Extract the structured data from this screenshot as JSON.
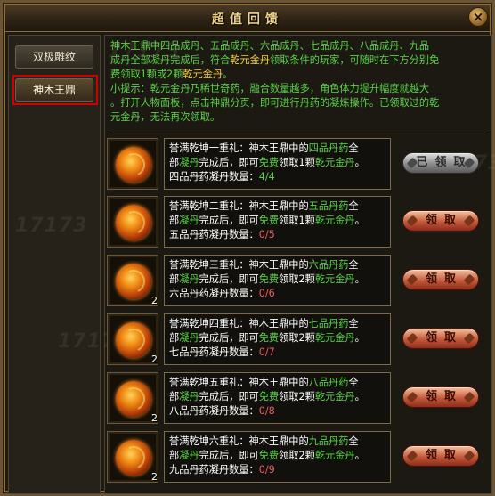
{
  "window": {
    "title": "超值回馈",
    "close_label": "×"
  },
  "sidebar": {
    "items": [
      {
        "label": "双极雕纹"
      },
      {
        "label": "神木王鼎"
      }
    ]
  },
  "description": {
    "line1": "神木王鼎中四品成丹、五品成丹、六品成丹、七品成丹、八品成丹、九品",
    "line2a": "成丹全部凝丹完成后，符合",
    "line2b": "乾元金丹",
    "line2c": "领取条件的玩家，可随时在下方分别免",
    "line3a": "费领取1颗或2颗",
    "line3b": "乾元金丹",
    "line3c": "。",
    "line4": "    小提示：乾元金丹乃稀世奇药，融合数量越多，角色体力提升幅度就越大",
    "line5": "。打开人物面板，点击神鼎分页，即可进行丹药的凝炼操作。已领取过的乾",
    "line6": "元金丹，无法再次领取。"
  },
  "watermark": "17173",
  "rewards": [
    {
      "count": "",
      "l1a": "誉满乾坤一重礼：神木王鼎中的",
      "l1b": "四品丹药",
      "l1c": "全",
      "l2a": "部",
      "l2b": "凝丹",
      "l2c": "完成后，即可",
      "l2d": "免费",
      "l2e": "领取1颗",
      "l2f": "乾元金丹",
      "l2g": "。",
      "l3a": "四品丹药凝丹数量：",
      "l3b": "4/4",
      "claim": "已领取",
      "claimed": true
    },
    {
      "count": "",
      "l1a": "誉满乾坤二重礼：神木王鼎中的",
      "l1b": "五品丹药",
      "l1c": "全",
      "l2a": "部",
      "l2b": "凝丹",
      "l2c": "完成后，即可",
      "l2d": "免费",
      "l2e": "领取1颗",
      "l2f": "乾元金丹",
      "l2g": "。",
      "l3a": "五品丹药凝丹数量：",
      "l3b": "0/5",
      "claim": "领取",
      "claimed": false
    },
    {
      "count": "2",
      "l1a": "誉满乾坤三重礼：神木王鼎中的",
      "l1b": "六品丹药",
      "l1c": "全",
      "l2a": "部",
      "l2b": "凝丹",
      "l2c": "完成后，即可",
      "l2d": "免费",
      "l2e": "领取2颗",
      "l2f": "乾元金丹",
      "l2g": "。",
      "l3a": "六品丹药凝丹数量：",
      "l3b": "0/6",
      "claim": "领取",
      "claimed": false
    },
    {
      "count": "2",
      "l1a": "誉满乾坤四重礼：神木王鼎中的",
      "l1b": "七品丹药",
      "l1c": "全",
      "l2a": "部",
      "l2b": "凝丹",
      "l2c": "完成后，即可",
      "l2d": "免费",
      "l2e": "领取2颗",
      "l2f": "乾元金丹",
      "l2g": "。",
      "l3a": "七品丹药凝丹数量：",
      "l3b": "0/7",
      "claim": "领取",
      "claimed": false
    },
    {
      "count": "2",
      "l1a": "誉满乾坤五重礼：神木王鼎中的",
      "l1b": "八品丹药",
      "l1c": "全",
      "l2a": "部",
      "l2b": "凝丹",
      "l2c": "完成后，即可",
      "l2d": "免费",
      "l2e": "领取2颗",
      "l2f": "乾元金丹",
      "l2g": "。",
      "l3a": "八品丹药凝丹数量：",
      "l3b": "0/8",
      "claim": "领取",
      "claimed": false
    },
    {
      "count": "2",
      "l1a": "誉满乾坤六重礼：神木王鼎中的",
      "l1b": "九品丹药",
      "l1c": "全",
      "l2a": "部",
      "l2b": "凝丹",
      "l2c": "完成后，即可",
      "l2d": "免费",
      "l2e": "领取2颗",
      "l2f": "乾元金丹",
      "l2g": "。",
      "l3a": "九品丹药凝丹数量：",
      "l3b": "0/9",
      "claim": "领取",
      "claimed": false
    }
  ]
}
